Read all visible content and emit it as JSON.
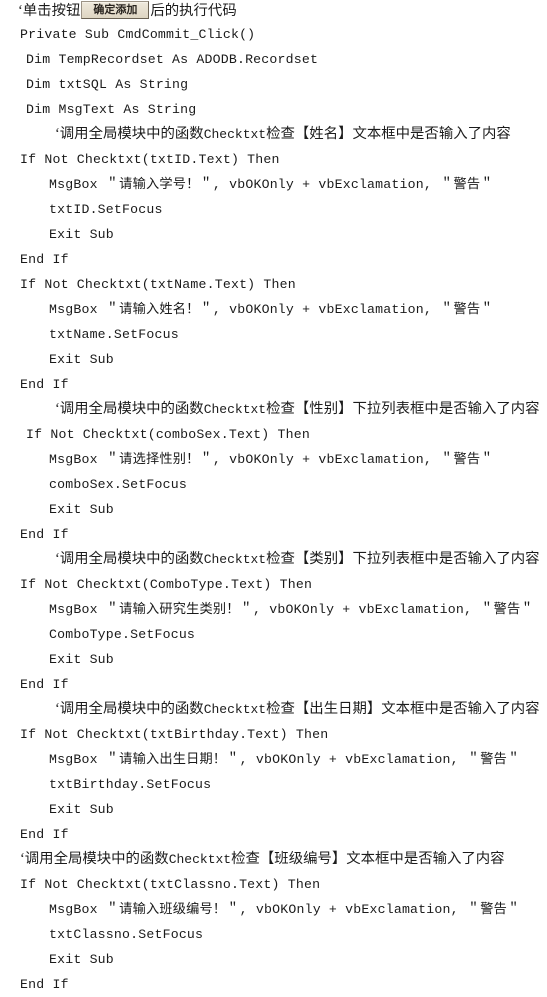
{
  "document": {
    "title": "VB 学生信息添加按钮事件代码",
    "language": "Visual Basic",
    "background_color": "#ffffff",
    "text_color": "#1a1a1a",
    "button_face_color": "#ded5c2",
    "button_border_color": "#6b6254"
  },
  "header_line": {
    "prefix": "‘单击按钮",
    "button_label": "确定添加",
    "suffix": "后的执行代码"
  },
  "lines": [
    {
      "indent": 1,
      "text": "Private Sub CmdCommit_Click()",
      "kind": "code"
    },
    {
      "indent": 2,
      "text": "Dim TempRecordset As ADODB.Recordset",
      "kind": "code"
    },
    {
      "indent": 2,
      "text": "Dim txtSQL As String",
      "kind": "code"
    },
    {
      "indent": 2,
      "text": "Dim MsgText As String",
      "kind": "code"
    },
    {
      "indent": 2,
      "text": "‘调用全局模块中的函数Checktxt检查【姓名】文本框中是否输入了内容",
      "kind": "comment"
    },
    {
      "indent": 1,
      "text": "If Not Checktxt(txtID.Text) Then",
      "kind": "code"
    },
    {
      "indent": 3,
      "text": "MsgBox ＂请输入学号！＂, vbOKOnly + vbExclamation, ＂警告＂",
      "kind": "code"
    },
    {
      "indent": 3,
      "text": "txtID.SetFocus",
      "kind": "code"
    },
    {
      "indent": 3,
      "text": "Exit Sub",
      "kind": "code"
    },
    {
      "indent": 1,
      "text": "End If",
      "kind": "code"
    },
    {
      "indent": 1,
      "text": "If Not Checktxt(txtName.Text) Then",
      "kind": "code"
    },
    {
      "indent": 3,
      "text": "MsgBox ＂请输入姓名！＂, vbOKOnly + vbExclamation, ＂警告＂",
      "kind": "code"
    },
    {
      "indent": 3,
      "text": "txtName.SetFocus",
      "kind": "code"
    },
    {
      "indent": 3,
      "text": "Exit Sub",
      "kind": "code"
    },
    {
      "indent": 1,
      "text": "End If",
      "kind": "code"
    },
    {
      "indent": 2,
      "text": "‘调用全局模块中的函数Checktxt检查【性别】下拉列表框中是否输入了内容",
      "kind": "comment"
    },
    {
      "indent": 2,
      "text": "If Not Checktxt(comboSex.Text) Then",
      "kind": "code"
    },
    {
      "indent": 3,
      "text": "MsgBox ＂请选择性别！＂, vbOKOnly + vbExclamation, ＂警告＂",
      "kind": "code"
    },
    {
      "indent": 3,
      "text": "comboSex.SetFocus",
      "kind": "code"
    },
    {
      "indent": 3,
      "text": "Exit Sub",
      "kind": "code"
    },
    {
      "indent": 1,
      "text": "End If",
      "kind": "code"
    },
    {
      "indent": 2,
      "text": "‘调用全局模块中的函数Checktxt检查【类别】下拉列表框中是否输入了内容",
      "kind": "comment"
    },
    {
      "indent": 1,
      "text": "If Not Checktxt(ComboType.Text) Then",
      "kind": "code"
    },
    {
      "indent": 3,
      "text": "MsgBox ＂请输入研究生类别！＂, vbOKOnly + vbExclamation, ＂警告＂",
      "kind": "code"
    },
    {
      "indent": 3,
      "text": "ComboType.SetFocus",
      "kind": "code"
    },
    {
      "indent": 3,
      "text": "Exit Sub",
      "kind": "code"
    },
    {
      "indent": 1,
      "text": "End If",
      "kind": "code"
    },
    {
      "indent": 2,
      "text": "‘调用全局模块中的函数Checktxt检查【出生日期】文本框中是否输入了内容",
      "kind": "comment"
    },
    {
      "indent": 1,
      "text": "If Not Checktxt(txtBirthday.Text) Then",
      "kind": "code"
    },
    {
      "indent": 3,
      "text": "MsgBox ＂请输入出生日期！＂, vbOKOnly + vbExclamation, ＂警告＂",
      "kind": "code"
    },
    {
      "indent": 3,
      "text": "txtBirthday.SetFocus",
      "kind": "code"
    },
    {
      "indent": 3,
      "text": "Exit Sub",
      "kind": "code"
    },
    {
      "indent": 1,
      "text": "End If",
      "kind": "code"
    },
    {
      "indent": 0,
      "text": "‘调用全局模块中的函数Checktxt检查【班级编号】文本框中是否输入了内容",
      "kind": "comment"
    },
    {
      "indent": 1,
      "text": "If Not Checktxt(txtClassno.Text) Then",
      "kind": "code"
    },
    {
      "indent": 3,
      "text": "MsgBox ＂请输入班级编号！＂, vbOKOnly + vbExclamation, ＂警告＂",
      "kind": "code"
    },
    {
      "indent": 3,
      "text": "txtClassno.SetFocus",
      "kind": "code"
    },
    {
      "indent": 3,
      "text": "Exit Sub",
      "kind": "code"
    },
    {
      "indent": 1,
      "text": "End If",
      "kind": "code"
    }
  ]
}
